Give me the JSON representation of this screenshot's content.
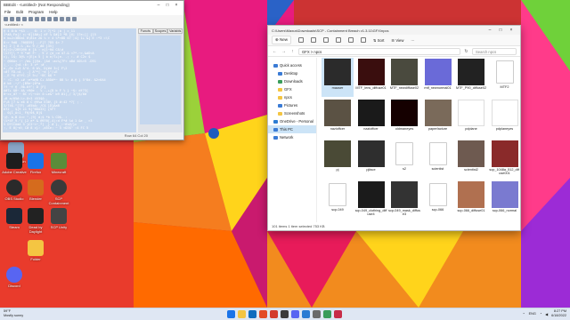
{
  "desktop": {
    "icons": [
      {
        "label": "Recycle Bin",
        "color": "#8aa6c8"
      },
      {
        "label": "Adobe Creative",
        "color": "#1d1d1d"
      },
      {
        "label": "Firefox",
        "color": "#1a73e8"
      },
      {
        "label": "Minecraft",
        "color": "#5b8c3a"
      },
      {
        "label": "OBS Studio",
        "color": "#2a2a2a"
      },
      {
        "label": "Blender",
        "color": "#d56b1d"
      },
      {
        "label": "SCP Containment",
        "color": "#3a3a3a"
      },
      {
        "label": "Steam",
        "color": "#1b2838"
      },
      {
        "label": "Dead by Daylight",
        "color": "#222"
      },
      {
        "label": "SCP Unity",
        "color": "#444"
      },
      {
        "label": "Discord",
        "color": "#5865f2"
      },
      {
        "label": "Folder",
        "color": "#f4c542"
      }
    ]
  },
  "bbedit": {
    "title": "BBEdit - <untitled> (Not Responding)",
    "menu": [
      "File",
      "Edit",
      "Program",
      "Help"
    ],
    "tab": "<untitled> ×",
    "side_tabs": [
      "Functs",
      "Scopes",
      "Variabls"
    ],
    "status": "Row 64 Col 20"
  },
  "explorer": {
    "title": "C:\\Users\\Maxus\\Downloads\\SCP - Containment Breach v1.3.11\\GFX\\npcs",
    "new_label": "New",
    "sort_label": "Sort",
    "view_label": "View",
    "breadcrumb": "GFX  >  npcs",
    "search_placeholder": "Search npcs",
    "nav": [
      {
        "label": "Quick access",
        "color": "#3a7bd5",
        "indent": false
      },
      {
        "label": "Desktop",
        "color": "#3a7bd5",
        "indent": true
      },
      {
        "label": "Downloads",
        "color": "#3a9d5b",
        "indent": true
      },
      {
        "label": "GFX",
        "color": "#f4c542",
        "indent": true
      },
      {
        "label": "npcs",
        "color": "#f4c542",
        "indent": true
      },
      {
        "label": "Pictures",
        "color": "#3a7bd5",
        "indent": true
      },
      {
        "label": "Screenshots",
        "color": "#f4c542",
        "indent": true
      },
      {
        "label": "OneDrive - Personal",
        "color": "#2b7cd3",
        "indent": false
      },
      {
        "label": "This PC",
        "color": "#3a7bd5",
        "indent": false
      },
      {
        "label": "Network",
        "color": "#3a7bd5",
        "indent": false
      }
    ],
    "files": [
      {
        "name": "mauser",
        "thumb": "#2b2b2b"
      },
      {
        "name": "MTF_lens_diffuse01",
        "thumb": "#3a0e0e"
      },
      {
        "name": "MTF_newdiffuse02",
        "thumb": "#4a4a3e"
      },
      {
        "name": "mtf_newnormal01",
        "thumb": "#6a6ad8"
      },
      {
        "name": "MTF_P90_diffuse02",
        "thumb": "#222"
      },
      {
        "name": "MTF2",
        "thumb": "file"
      },
      {
        "name": "nazioffcer",
        "thumb": "#5b5244"
      },
      {
        "name": "nazioffcer",
        "thumb": "#1a1a1a"
      },
      {
        "name": "oldmaneyes",
        "thumb": "#150000"
      },
      {
        "name": "paperfacture",
        "thumb": "#7a6a5a"
      },
      {
        "name": "pdplane",
        "thumb": "#ffffff"
      },
      {
        "name": "pdplaneyes",
        "thumb": "#ffffff"
      },
      {
        "name": "pj",
        "thumb": "#4a4a36"
      },
      {
        "name": "pjface",
        "thumb": "#2e2e2e"
      },
      {
        "name": "s2",
        "thumb": "file"
      },
      {
        "name": "scientist",
        "thumb": "file"
      },
      {
        "name": "scientist2",
        "thumb": "#6e5a50"
      },
      {
        "name": "scp_1048a_512_diffuse001",
        "thumb": "#8a2a2a"
      },
      {
        "name": "scp-049",
        "thumb": "file"
      },
      {
        "name": "scp-049_clothing_diffuse4",
        "thumb": "#1b1b1b"
      },
      {
        "name": "scp-049_mask_diffuse3",
        "thumb": "#333"
      },
      {
        "name": "scp-066",
        "thumb": "file"
      },
      {
        "name": "scp-066_diffuse01",
        "thumb": "#b07050"
      },
      {
        "name": "scp-066_normal",
        "thumb": "#7a7ad0"
      }
    ],
    "status": "101 items   1 item selected  753 KB",
    "selected_index": 0
  },
  "taskbar": {
    "weather_temp": "59°F",
    "weather_text": "Mostly sunny",
    "lang": "ENG",
    "time": "8:27 PM",
    "date": "6/18/2022",
    "apps": [
      "#1a73e8",
      "#f4c542",
      "#0f6cbd",
      "#e34c26",
      "#d33b2c",
      "#3a3a3a",
      "#5865f2",
      "#2b7cd3",
      "#6b6b6b",
      "#3a9d5b",
      "#c72c48"
    ]
  }
}
